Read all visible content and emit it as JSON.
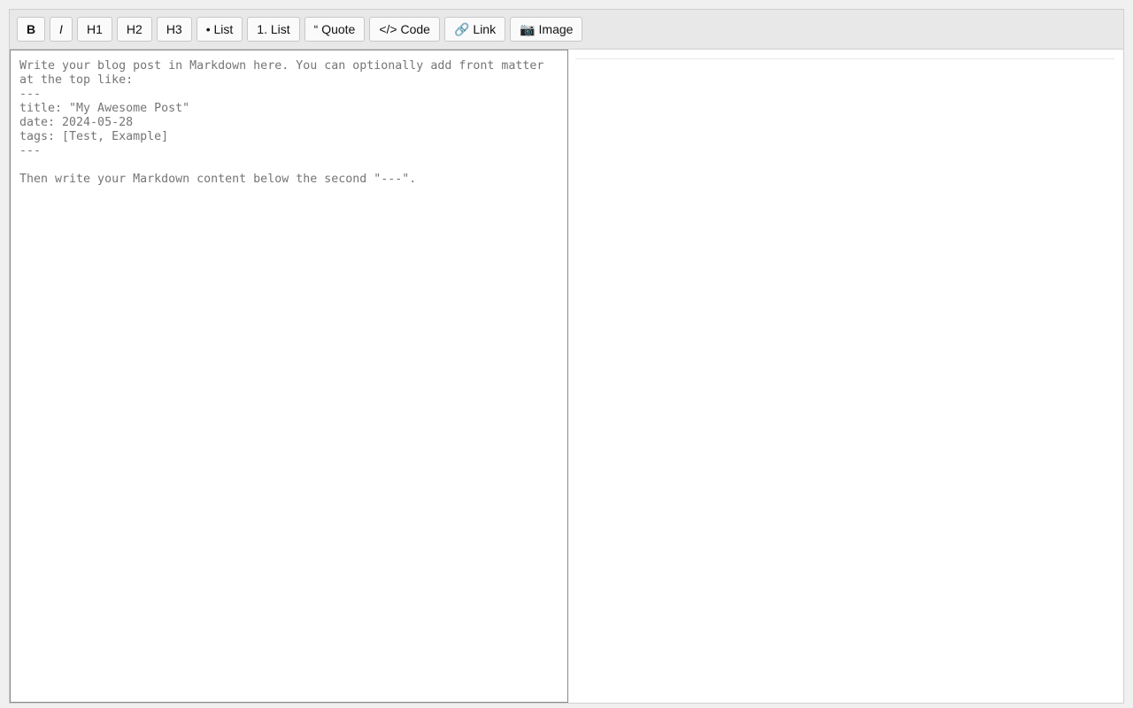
{
  "toolbar": {
    "buttons": [
      {
        "label": "B"
      },
      {
        "label": "I"
      },
      {
        "label": "H1"
      },
      {
        "label": "H2"
      },
      {
        "label": "H3"
      },
      {
        "label": "• List"
      },
      {
        "label": "1. List"
      },
      {
        "label": "“ Quote"
      },
      {
        "label": "</> Code"
      },
      {
        "glyph": "🔗",
        "label": "Link",
        "icon": "link-icon"
      },
      {
        "glyph": "📷",
        "label": "Image",
        "icon": "camera-icon"
      }
    ]
  },
  "editor": {
    "value": "",
    "placeholder": "Write your blog post in Markdown here. You can optionally add front matter at the top like:\n---\ntitle: \"My Awesome Post\"\ndate: 2024-05-28\ntags: [Test, Example]\n---\n\nThen write your Markdown content below the second \"---\"."
  },
  "preview": {
    "content": ""
  }
}
